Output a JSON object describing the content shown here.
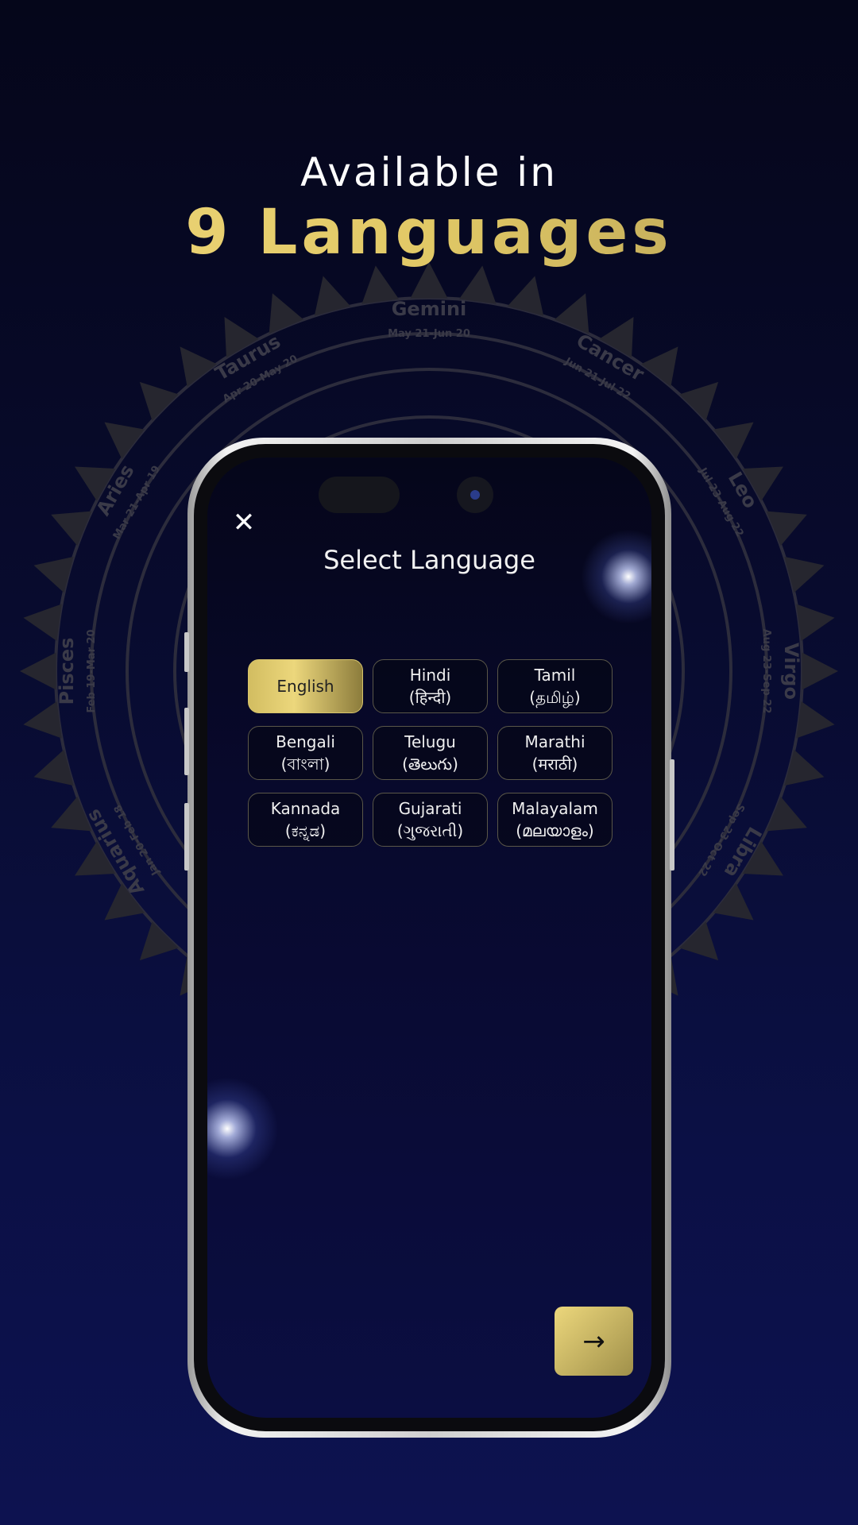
{
  "promo": {
    "line1": "Available in",
    "line2": "9 Languages"
  },
  "zodiac": [
    {
      "name": "Gemini",
      "dates": "May 21-Jun 20"
    },
    {
      "name": "Taurus",
      "dates": "Apr 20-May 20"
    },
    {
      "name": "Cancer",
      "dates": "Jun 21-Jul 22"
    },
    {
      "name": "Aries",
      "dates": "Mar 21-Apr 19"
    },
    {
      "name": "Leo",
      "dates": "Jul 23-Aug 22"
    },
    {
      "name": "Pisces",
      "dates": "Feb 19-Mar 20"
    },
    {
      "name": "Virgo",
      "dates": "Aug 23-Sep 22"
    },
    {
      "name": "Aquarius",
      "dates": "Jan 20-Feb 18"
    },
    {
      "name": "Libra",
      "dates": "Sep 23-Oct 22"
    }
  ],
  "screen": {
    "close_icon": "close-icon",
    "title": "Select Language",
    "selected": "English",
    "languages": [
      {
        "name": "English",
        "native": ""
      },
      {
        "name": "Hindi",
        "native": "(हिन्दी)"
      },
      {
        "name": "Tamil",
        "native": "(தமிழ்)"
      },
      {
        "name": "Bengali",
        "native": "(বাংলা)"
      },
      {
        "name": "Telugu",
        "native": "(తెలుగు)"
      },
      {
        "name": "Marathi",
        "native": "(मराठी)"
      },
      {
        "name": "Kannada",
        "native": "(ಕನ್ನಡ)"
      },
      {
        "name": "Gujarati",
        "native": "(ગુજરાતી)"
      },
      {
        "name": "Malayalam",
        "native": "(മലയാളം)"
      }
    ],
    "next_icon": "arrow-right-icon",
    "next_symbol": "→",
    "close_symbol": "✕"
  },
  "colors": {
    "accent_gold": "#e1c866",
    "background": "#080b2e"
  }
}
